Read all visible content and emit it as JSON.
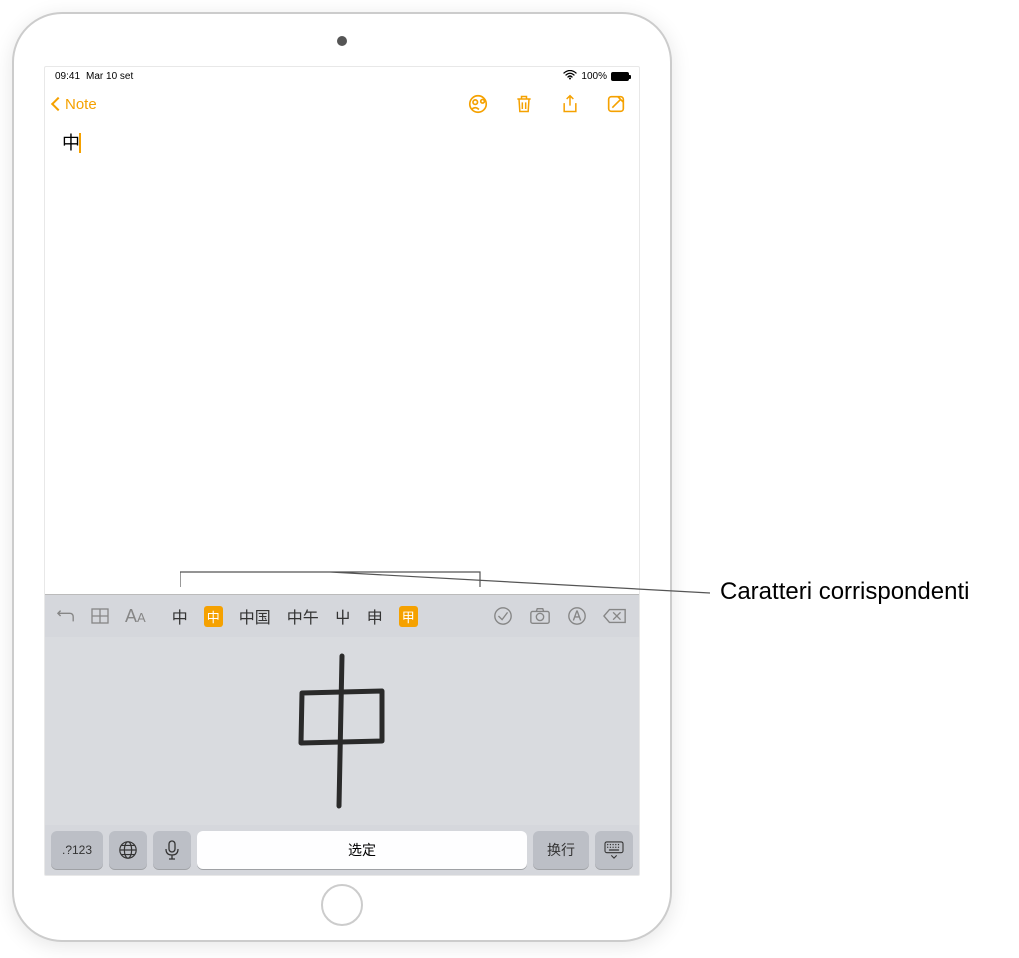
{
  "status_bar": {
    "time": "09:41",
    "date": "Mar 10 set",
    "battery_percent": "100%"
  },
  "nav": {
    "back_label": "Note"
  },
  "note": {
    "entered_text": "中"
  },
  "candidates": {
    "items": [
      {
        "text": "中",
        "highlighted": false
      },
      {
        "text": "中",
        "highlighted": true
      },
      {
        "text": "中国",
        "highlighted": false
      },
      {
        "text": "中午",
        "highlighted": false
      },
      {
        "text": "屮",
        "highlighted": false
      },
      {
        "text": "申",
        "highlighted": false
      },
      {
        "text": "甲",
        "highlighted": true
      }
    ]
  },
  "keyboard": {
    "numbers_key": ".?123",
    "space_label": "选定",
    "return_label": "换行"
  },
  "callout": {
    "matching_characters": "Caratteri corrispondenti"
  }
}
